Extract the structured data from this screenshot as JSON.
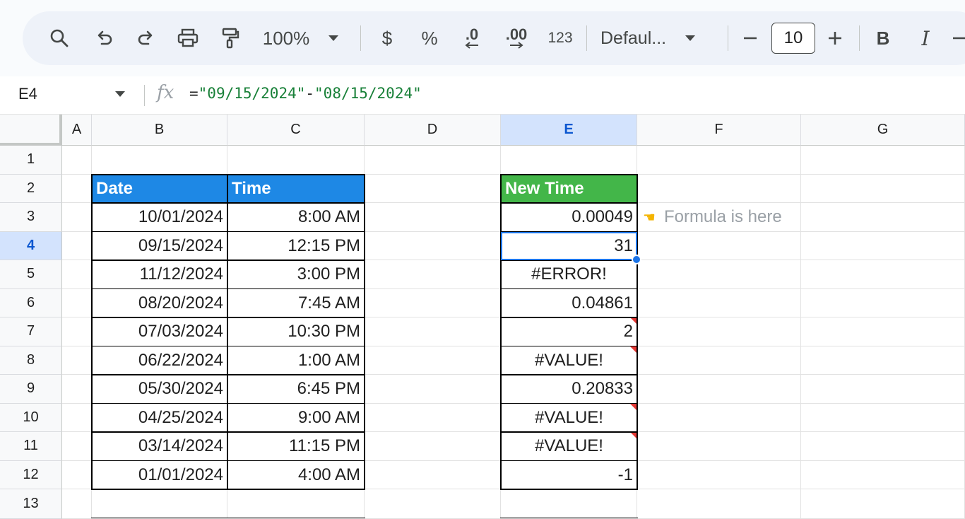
{
  "toolbar": {
    "zoom": "100%",
    "currency_label": "$",
    "percent_label": "%",
    "dec_decrease_label": ".0",
    "dec_increase_label": ".00",
    "number_format_label": "123",
    "font_name": "Defaul...",
    "font_size": "10",
    "bold_label": "B",
    "italic_label": "I"
  },
  "formula_bar": {
    "cell_ref": "E4",
    "fx_label": "fx",
    "formula_prefix": "=",
    "formula_arg1": "\"09/15/2024\"",
    "formula_op": "-",
    "formula_arg2": "\"08/15/2024\""
  },
  "columns": [
    "A",
    "B",
    "C",
    "D",
    "E",
    "F",
    "G"
  ],
  "selected_column": "E",
  "rows": [
    "1",
    "2",
    "3",
    "4",
    "5",
    "6",
    "7",
    "8",
    "9",
    "10",
    "11",
    "12",
    "13"
  ],
  "selected_row": "4",
  "table": {
    "headers": {
      "date": "Date",
      "time": "Time",
      "new_time": "New Time"
    },
    "rows": [
      {
        "date": "10/01/2024",
        "time": "8:00 AM",
        "new_time": "0.00049",
        "flag": false
      },
      {
        "date": "09/15/2024",
        "time": "12:15 PM",
        "new_time": "31",
        "flag": false
      },
      {
        "date": "11/12/2024",
        "time": "3:00 PM",
        "new_time": "#ERROR!",
        "flag": false
      },
      {
        "date": "08/20/2024",
        "time": "7:45 AM",
        "new_time": "0.04861",
        "flag": false
      },
      {
        "date": "07/03/2024",
        "time": "10:30 PM",
        "new_time": "2",
        "flag": true
      },
      {
        "date": "06/22/2024",
        "time": "1:00 AM",
        "new_time": "#VALUE!",
        "flag": true
      },
      {
        "date": "05/30/2024",
        "time": "6:45 PM",
        "new_time": "0.20833",
        "flag": false
      },
      {
        "date": "04/25/2024",
        "time": "9:00 AM",
        "new_time": "#VALUE!",
        "flag": true
      },
      {
        "date": "03/14/2024",
        "time": "11:15 PM",
        "new_time": "#VALUE!",
        "flag": true
      },
      {
        "date": "01/01/2024",
        "time": "4:00 AM",
        "new_time": "-1",
        "flag": false
      }
    ]
  },
  "note": {
    "icon": "pointing-hand-icon",
    "text": "Formula is here"
  },
  "colors": {
    "header_blue": "#1e88e5",
    "header_green": "#43b649",
    "selection": "#1a73e8",
    "error_flag": "#e53935",
    "formula_string": "#188038"
  }
}
